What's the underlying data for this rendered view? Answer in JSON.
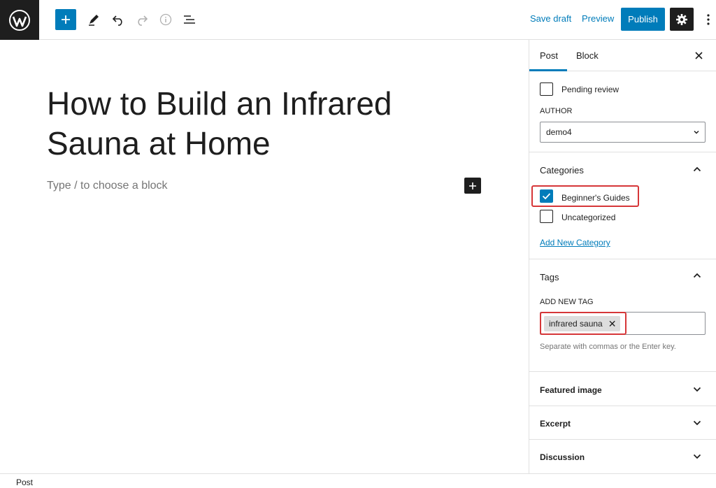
{
  "toolbar": {
    "save_draft": "Save draft",
    "preview": "Preview",
    "publish": "Publish"
  },
  "editor": {
    "title": "How to Build an Infrared Sauna at Home",
    "placeholder": "Type / to choose a block"
  },
  "sidebar": {
    "tabs": [
      "Post",
      "Block"
    ],
    "active_tab": "Post",
    "pending_review": "Pending review",
    "author_label": "AUTHOR",
    "author_value": "demo4",
    "categories": {
      "title": "Categories",
      "items": [
        {
          "label": "Beginner's Guides",
          "checked": true
        },
        {
          "label": "Uncategorized",
          "checked": false
        }
      ],
      "add_new": "Add New Category"
    },
    "tags": {
      "title": "Tags",
      "add_label": "ADD NEW TAG",
      "chips": [
        "infrared sauna"
      ],
      "help": "Separate with commas or the Enter key."
    },
    "panels": [
      "Featured image",
      "Excerpt",
      "Discussion"
    ]
  },
  "status_bar": {
    "label": "Post"
  },
  "colors": {
    "accent": "#007cba",
    "dark": "#1e1e1e",
    "highlight": "#d63638"
  }
}
